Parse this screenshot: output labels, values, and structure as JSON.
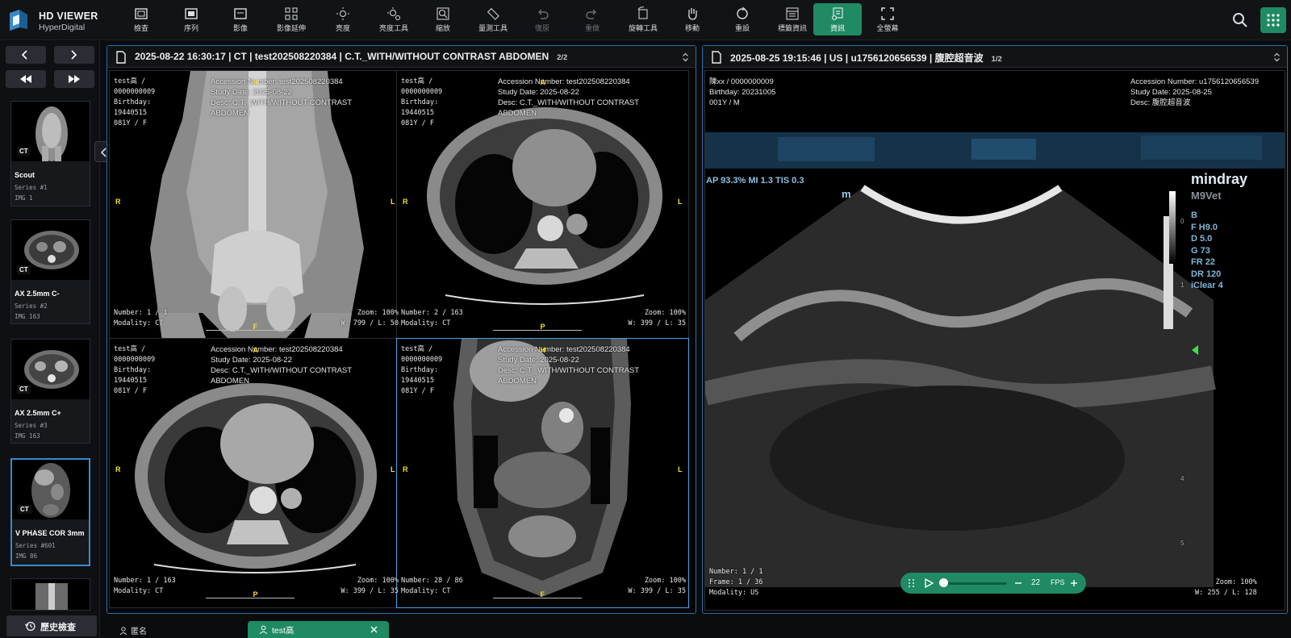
{
  "app": {
    "title": "HD VIEWER",
    "subtitle": "HyperDigital"
  },
  "toolbar": [
    {
      "label": "檢查",
      "icon": "study-icon",
      "disabled": false,
      "active": false
    },
    {
      "label": "序列",
      "icon": "series-icon",
      "disabled": false,
      "active": false
    },
    {
      "label": "影像",
      "icon": "image-icon",
      "disabled": false,
      "active": false
    },
    {
      "label": "影像延伸",
      "icon": "layout-grid-icon",
      "disabled": false,
      "active": false
    },
    {
      "label": "亮度",
      "icon": "brightness-icon",
      "disabled": false,
      "active": false
    },
    {
      "label": "亮度工具",
      "icon": "brightness-tool-icon",
      "disabled": false,
      "active": false
    },
    {
      "label": "縮放",
      "icon": "zoom-icon",
      "disabled": false,
      "active": false
    },
    {
      "label": "量測工具",
      "icon": "ruler-icon",
      "disabled": false,
      "active": false
    },
    {
      "label": "復原",
      "icon": "undo-icon",
      "disabled": true,
      "active": false
    },
    {
      "label": "重做",
      "icon": "redo-icon",
      "disabled": true,
      "active": false
    },
    {
      "label": "旋轉工具",
      "icon": "rotate-icon",
      "disabled": false,
      "active": false
    },
    {
      "label": "移動",
      "icon": "pan-hand-icon",
      "disabled": false,
      "active": false
    },
    {
      "label": "重設",
      "icon": "reset-icon",
      "disabled": false,
      "active": false
    },
    {
      "label": "標籤資訊",
      "icon": "tag-info-icon",
      "disabled": false,
      "active": false
    },
    {
      "label": "資訊",
      "icon": "info-icon",
      "disabled": false,
      "active": true
    },
    {
      "label": "全螢幕",
      "icon": "fullscreen-icon",
      "disabled": false,
      "active": false
    }
  ],
  "sidebar": {
    "thumbnails": [
      {
        "modality": "CT",
        "name": "Scout",
        "series": "Series #1",
        "img": "IMG 1",
        "selected": false
      },
      {
        "modality": "CT",
        "name": "AX 2.5mm C-",
        "series": "Series #2",
        "img": "IMG 163",
        "selected": false
      },
      {
        "modality": "CT",
        "name": "AX 2.5mm C+",
        "series": "Series #3",
        "img": "IMG 163",
        "selected": false
      },
      {
        "modality": "CT",
        "name": "V PHASE COR 3mm",
        "series": "Series #601",
        "img": "IMG 86",
        "selected": true
      }
    ],
    "history_label": "歷史檢查"
  },
  "left_panel": {
    "title": "2025-08-22 16:30:17 | CT | test202508220384 | C.T._WITH/WITHOUT CONTRAST ABDOMEN",
    "count": "2/2",
    "viewports": [
      {
        "patient": "test高 /\n0000000009\nBirthday:\n19440515\n081Y / F",
        "accession": "Accession Number: test202508220384",
        "study_date": "Study Date: 2025-08-22",
        "desc": "Desc: C.T._WITH/WITHOUT CONTRAST\nABDOMEN",
        "number": "Number: 1 / 1\nModality: CT",
        "zoom": "Zoom: 100%\nW: 799 / L: 50",
        "orient": {
          "top": "H",
          "bottom": "F",
          "left": "R",
          "right": "L"
        }
      },
      {
        "patient": "test高 /\n0000000009\nBirthday:\n19440515\n081Y / F",
        "accession": "Accession Number: test202508220384",
        "study_date": "Study Date: 2025-08-22",
        "desc": "Desc: C.T._WITH/WITHOUT CONTRAST\nABDOMEN",
        "number": "Number: 2 / 163\nModality: CT",
        "zoom": "Zoom: 100%\nW: 399 / L: 35",
        "orient": {
          "top": "A",
          "bottom": "P",
          "left": "R",
          "right": "L"
        }
      },
      {
        "patient": "test高 /\n0000000009\nBirthday:\n19440515\n081Y / F",
        "accession": "Accession Number: test202508220384",
        "study_date": "Study Date: 2025-08-22",
        "desc": "Desc: C.T._WITH/WITHOUT CONTRAST\nABDOMEN",
        "number": "Number: 1 / 163\nModality: CT",
        "zoom": "Zoom: 100%\nW: 399 / L: 35",
        "orient": {
          "top": "A",
          "bottom": "P",
          "left": "R",
          "right": "L"
        }
      },
      {
        "patient": "test高 /\n0000000009\nBirthday:\n19440515\n081Y / F",
        "accession": "Accession Number: test202508220384",
        "study_date": "Study Date: 2025-08-22",
        "desc": "Desc: C.T._WITH/WITHOUT CONTRAST\nABDOMEN",
        "number": "Number: 28 / 86\nModality: CT",
        "zoom": "Zoom: 100%\nW: 399 / L: 35",
        "orient": {
          "top": "H",
          "bottom": "F",
          "left": "R",
          "right": "L"
        }
      }
    ]
  },
  "right_panel": {
    "title": "2025-08-25 19:15:46 | US | u1756120656539 | 腹腔超音波",
    "count": "1/2",
    "patient": "陳xx / 0000000009\nBirthday: 20231005\n001Y / M",
    "accession": "Accession Number: u1756120656539",
    "study_date": "Study Date: 2025-08-25",
    "desc": "Desc: 腹腔超音波",
    "number": "Number: 1 / 1\nFrame: 1 / 36\nModality: US",
    "zoom": "Zoom: 100%\nW: 255 / L: 128",
    "us_params": "AP 93.3%  MI 1.3 TIS 0.3",
    "brand": "mindray",
    "model": "M9Vet",
    "settings": "B\nF H9.0\nD 5.0\nG 73\nFR 22\nDR 120\niClear 4",
    "depth_ticks": [
      "0",
      "1",
      "4",
      "5"
    ],
    "player": {
      "fps_value": "22",
      "fps_label": "FPS",
      "progress": 0.0
    }
  },
  "bottom": {
    "anon_label": "匿名",
    "patient_tab": "test高"
  },
  "colors": {
    "accent": "#1f8a64",
    "panel_border": "#2a6fa6",
    "orientation": "#f5e12a"
  }
}
